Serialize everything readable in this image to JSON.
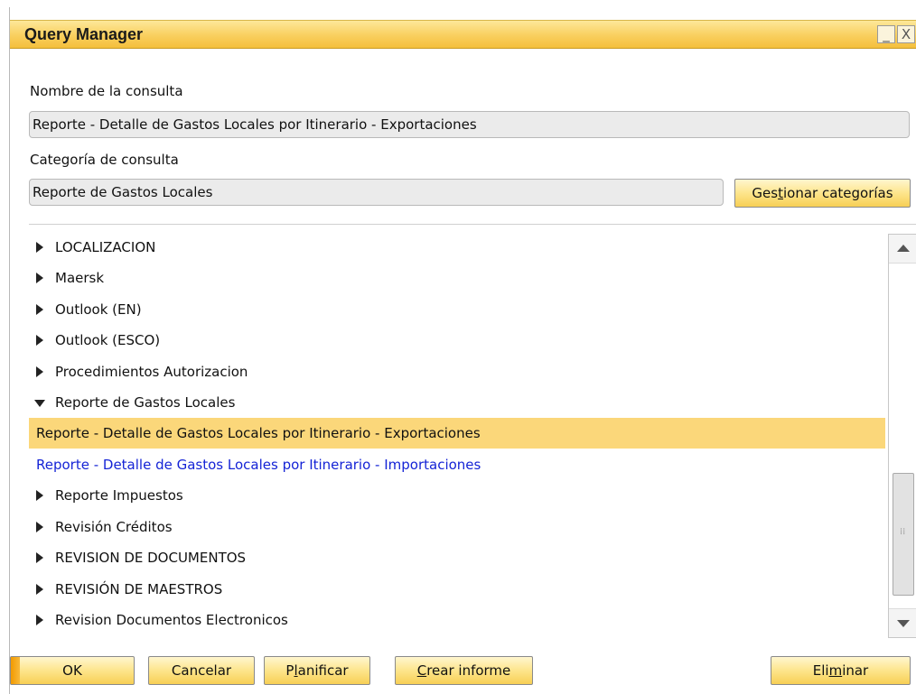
{
  "window": {
    "title": "Query Manager",
    "minimize_glyph": "_",
    "close_glyph": "X"
  },
  "query_name": {
    "label": "Nombre de la consulta",
    "value": "Reporte - Detalle de Gastos Locales por Itinerario - Exportaciones"
  },
  "query_category": {
    "label": "Categoría de consulta",
    "value": "Reporte de Gastos Locales"
  },
  "manage_categories_button": {
    "before": "Ges",
    "accel": "t",
    "after": "ionar categorías"
  },
  "tree": {
    "items": [
      {
        "label": "LOCALIZACION",
        "type": "collapsed"
      },
      {
        "label": "Maersk",
        "type": "collapsed"
      },
      {
        "label": "Outlook (EN)",
        "type": "collapsed"
      },
      {
        "label": "Outlook (ESCO)",
        "type": "collapsed"
      },
      {
        "label": "Procedimientos Autorizacion",
        "type": "collapsed"
      },
      {
        "label": "Reporte de Gastos Locales",
        "type": "expanded"
      },
      {
        "label": "Reporte - Detalle de Gastos Locales por Itinerario - Exportaciones",
        "type": "query-selected"
      },
      {
        "label": "Reporte - Detalle de Gastos Locales por Itinerario - Importaciones",
        "type": "query"
      },
      {
        "label": "Reporte Impuestos",
        "type": "collapsed"
      },
      {
        "label": "Revisión Créditos",
        "type": "collapsed"
      },
      {
        "label": "REVISION DE DOCUMENTOS",
        "type": "collapsed"
      },
      {
        "label": "REVISIÓN DE MAESTROS",
        "type": "collapsed"
      },
      {
        "label": "Revision Documentos Electronicos",
        "type": "collapsed"
      }
    ]
  },
  "buttons": {
    "ok": {
      "label": "OK"
    },
    "cancel": {
      "label": "Cancelar"
    },
    "schedule": {
      "before": "P",
      "accel": "l",
      "after": "anificar"
    },
    "create_report": {
      "before": "",
      "accel": "C",
      "after": "rear informe"
    },
    "delete": {
      "before": "Eli",
      "accel": "m",
      "after": "inar"
    }
  },
  "colors": {
    "titlebar": "#f9cf5e",
    "selected_row": "#fbd77a",
    "link_text": "#1524d6",
    "button_face": "#fde58c"
  }
}
